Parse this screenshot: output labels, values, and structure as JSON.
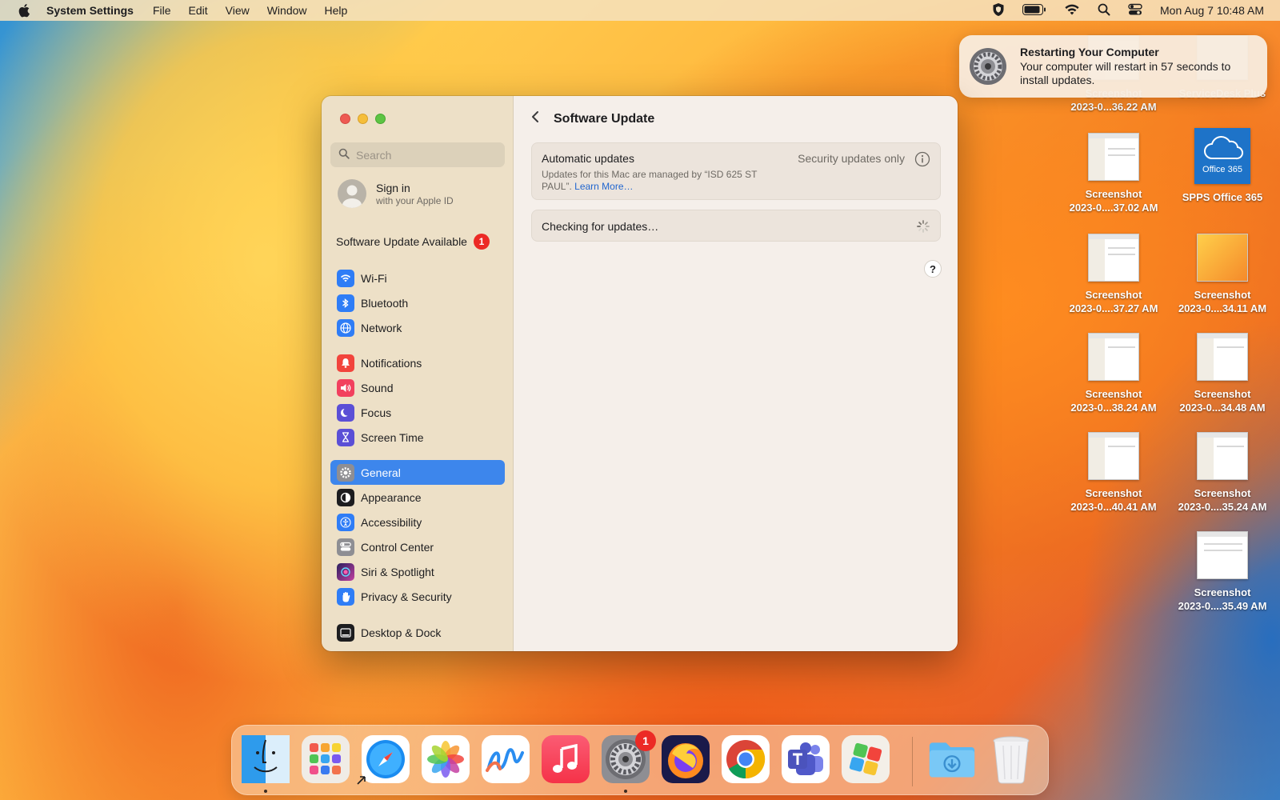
{
  "menubar": {
    "app_name": "System Settings",
    "menus": [
      "File",
      "Edit",
      "View",
      "Window",
      "Help"
    ],
    "clock": "Mon Aug 7  10:48 AM",
    "status_icons": [
      "shield-icon",
      "battery-icon",
      "wifi-icon",
      "search-icon",
      "control-center-icon"
    ]
  },
  "notification": {
    "title": "Restarting Your Computer",
    "body": "Your computer will restart in 57 seconds to install updates."
  },
  "sidebar": {
    "search_placeholder": "Search",
    "signin_title": "Sign in",
    "signin_subtitle": "with your Apple ID",
    "update_label": "Software Update Available",
    "update_badge": "1",
    "groups": [
      [
        {
          "label": "Wi-Fi",
          "icon": "wifi-icon",
          "color": "#2f7df6"
        },
        {
          "label": "Bluetooth",
          "icon": "bluetooth-icon",
          "color": "#2f7df6"
        },
        {
          "label": "Network",
          "icon": "globe-icon",
          "color": "#2f7df6"
        }
      ],
      [
        {
          "label": "Notifications",
          "icon": "bell-icon",
          "color": "#f2443c"
        },
        {
          "label": "Sound",
          "icon": "speaker-icon",
          "color": "#f2405e"
        },
        {
          "label": "Focus",
          "icon": "moon-icon",
          "color": "#5b4fd6"
        },
        {
          "label": "Screen Time",
          "icon": "hourglass-icon",
          "color": "#5b4fd6"
        }
      ],
      [
        {
          "label": "General",
          "icon": "gear-icon",
          "color": "#8e8e93",
          "selected": true
        },
        {
          "label": "Appearance",
          "icon": "appearance-icon",
          "color": "#1d1d1f"
        },
        {
          "label": "Accessibility",
          "icon": "accessibility-icon",
          "color": "#2f7df6"
        },
        {
          "label": "Control Center",
          "icon": "control-center-icon",
          "color": "#8e8e93"
        },
        {
          "label": "Siri & Spotlight",
          "icon": "siri-icon",
          "color": "#8a3fd6"
        },
        {
          "label": "Privacy & Security",
          "icon": "hand-icon",
          "color": "#2f7df6"
        }
      ],
      [
        {
          "label": "Desktop & Dock",
          "icon": "dock-icon",
          "color": "#1d1d1f"
        }
      ]
    ]
  },
  "main": {
    "title": "Software Update",
    "auto_updates": {
      "heading": "Automatic updates",
      "description": "Updates for this Mac are managed by “ISD 625 ST PAUL”.",
      "link": "Learn More…",
      "status": "Security updates only"
    },
    "checking": "Checking for updates…",
    "help": "?"
  },
  "desktop": {
    "icons": [
      {
        "line1": "Screenshot",
        "line2": "2023-0...36.22 AM"
      },
      {
        "line1": "ServiceDesk Plus",
        "line2": ""
      },
      {
        "line1": "Screenshot",
        "line2": "2023-0....37.02 AM"
      },
      {
        "line1": "SPPS Office 365",
        "line2": ""
      },
      {
        "line1": "Screenshot",
        "line2": "2023-0....37.27 AM"
      },
      {
        "line1": "Screenshot",
        "line2": "2023-0....34.11 AM"
      },
      {
        "line1": "Screenshot",
        "line2": "2023-0...38.24 AM"
      },
      {
        "line1": "Screenshot",
        "line2": "2023-0...34.48 AM"
      },
      {
        "line1": "Screenshot",
        "line2": "2023-0...40.41 AM"
      },
      {
        "line1": "Screenshot",
        "line2": "2023-0....35.24 AM"
      },
      {
        "line1": "Screenshot",
        "line2": "2023-0....35.49 AM"
      }
    ],
    "office_label": "Office 365"
  },
  "dock": {
    "apps": [
      "finder-icon",
      "launchpad-icon",
      "safari-icon",
      "photos-icon",
      "freeform-icon",
      "music-icon",
      "system-settings-icon",
      "firefox-icon",
      "chrome-icon",
      "teams-icon",
      "self-service-icon",
      "downloads-folder-icon",
      "trash-icon"
    ],
    "settings_badge": "1"
  }
}
